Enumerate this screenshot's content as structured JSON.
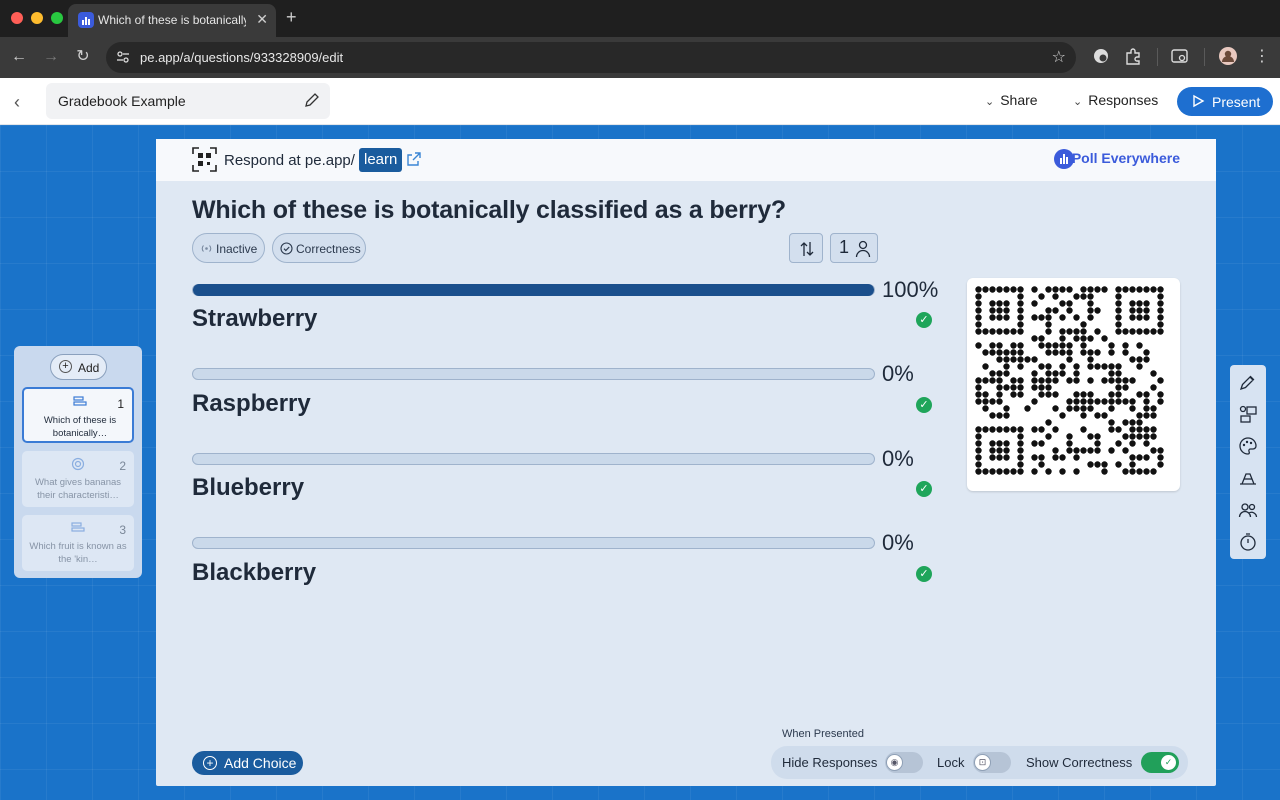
{
  "browser": {
    "tab_title": "Which of these is botanically",
    "url": "pe.app/a/questions/933328909/edit"
  },
  "header": {
    "title": "Gradebook Example",
    "share_label": "Share",
    "responses_label": "Responses",
    "present_label": "Present"
  },
  "sidebar": {
    "add_label": "Add",
    "slides": [
      {
        "number": "1",
        "text": "Which of these is botanically…",
        "icon": "bar-chart-icon"
      },
      {
        "number": "2",
        "text": "What gives bananas their characteristi…",
        "icon": "target-icon"
      },
      {
        "number": "3",
        "text": "Which fruit is known as the 'kin…",
        "icon": "bar-chart-icon"
      }
    ]
  },
  "card": {
    "respond_prefix": "Respond at pe.app/",
    "respond_tag": "learn",
    "brand": "Poll Everywhere",
    "question": "Which of these is botanically classified as a berry?",
    "status_pill": "Inactive",
    "correctness_pill": "Correctness",
    "response_count": "1"
  },
  "choices": [
    {
      "label": "Strawberry",
      "percent_text": "100%",
      "percent": 100,
      "correct": true
    },
    {
      "label": "Raspberry",
      "percent_text": "0%",
      "percent": 0,
      "correct": true
    },
    {
      "label": "Blueberry",
      "percent_text": "0%",
      "percent": 0,
      "correct": true
    },
    {
      "label": "Blackberry",
      "percent_text": "0%",
      "percent": 0,
      "correct": true
    }
  ],
  "footer": {
    "add_choice_label": "Add Choice",
    "when_presented": "When Presented",
    "hide_responses_label": "Hide Responses",
    "hide_responses_on": false,
    "lock_label": "Lock",
    "lock_on": false,
    "show_correctness_label": "Show Correctness",
    "show_correctness_on": true
  },
  "colors": {
    "accent": "#1e6fd0",
    "stage": "#1a73c9",
    "bar_fill": "#1a4f8c",
    "correct": "#1fa55a",
    "brand": "#3b5bdb"
  }
}
